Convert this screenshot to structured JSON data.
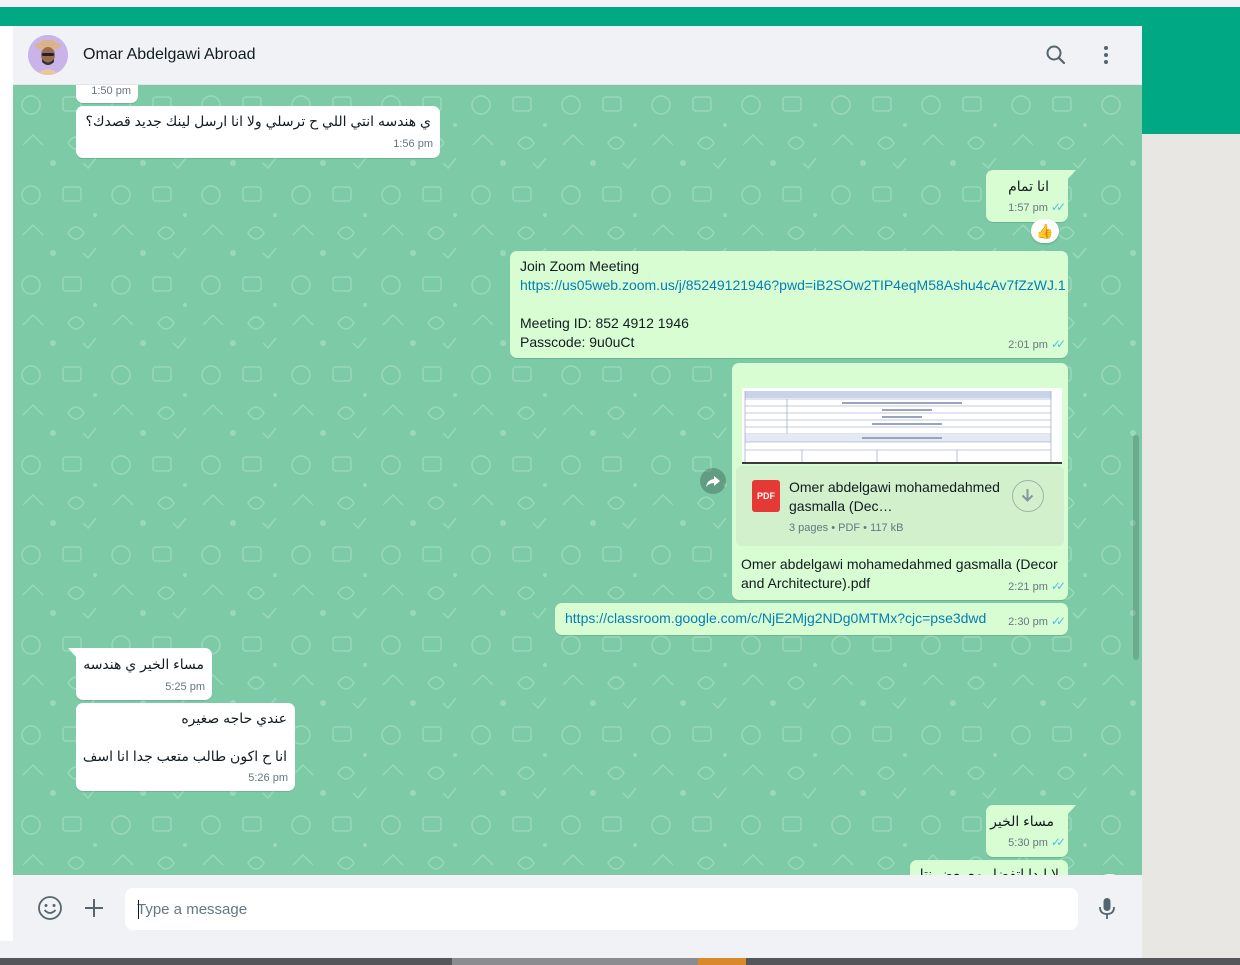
{
  "contact": {
    "name": "Omar Abdelgawi Abroad"
  },
  "messages": [
    {
      "type": "in",
      "text": "",
      "time": "1:50 pm"
    },
    {
      "type": "in",
      "text": "ي هندسه انتي اللي ح ترسلي ولا انا ارسل لينك جديد قصدك؟",
      "time": "1:56 pm"
    },
    {
      "type": "out",
      "text": "انا تمام",
      "time": "1:57 pm",
      "reaction": "👍"
    },
    {
      "type": "out",
      "lines": [
        "Join Zoom Meeting",
        "https://us05web.zoom.us/j/85249121946?pwd=iB2SOw2TIP4eqM58Ashu4cAv7fZzWJ.1",
        "",
        "Meeting ID: 852 4912 1946",
        "Passcode: 9u0uCt"
      ],
      "time": "2:01 pm"
    },
    {
      "type": "out",
      "doc": {
        "title": "Omer abdelgawi mohamedahmed gasmalla (Dec…",
        "meta": "3 pages • PDF • 117 kB",
        "icon_label": "PDF"
      },
      "caption": "Omer abdelgawi mohamedahmed gasmalla (Decor and Architecture).pdf",
      "time": "2:21 pm"
    },
    {
      "type": "out",
      "link": "https://classroom.google.com/c/NjE2Mjg2NDg0MTMx?cjc=pse3dwd",
      "time": "2:30 pm"
    },
    {
      "type": "in",
      "text": "مساء الخير ي هندسه",
      "time": "5:25 pm"
    },
    {
      "type": "in",
      "lines": [
        "عندي حاجه صغيره",
        "",
        "انا ح اكون طالب متعب جدا انا اسف"
      ],
      "time": "5:26 pm"
    },
    {
      "type": "out",
      "text": "مساء الخير",
      "time": "5:30 pm"
    },
    {
      "type": "out",
      "text": "لا ابدا اتفضل مع بعض نتا",
      "time": ""
    }
  ],
  "composer": {
    "placeholder": "Type a message"
  },
  "colors": {
    "accent": "#00a884",
    "chat_bg": "#7dcba6",
    "outgoing": "#d9fdd3",
    "incoming": "#ffffff",
    "read_ticks": "#53bdeb"
  },
  "icons": [
    "search-icon",
    "menu-icon",
    "emoji-icon",
    "attach-icon",
    "mic-icon",
    "forward-icon",
    "download-icon",
    "chevron-down-icon"
  ]
}
